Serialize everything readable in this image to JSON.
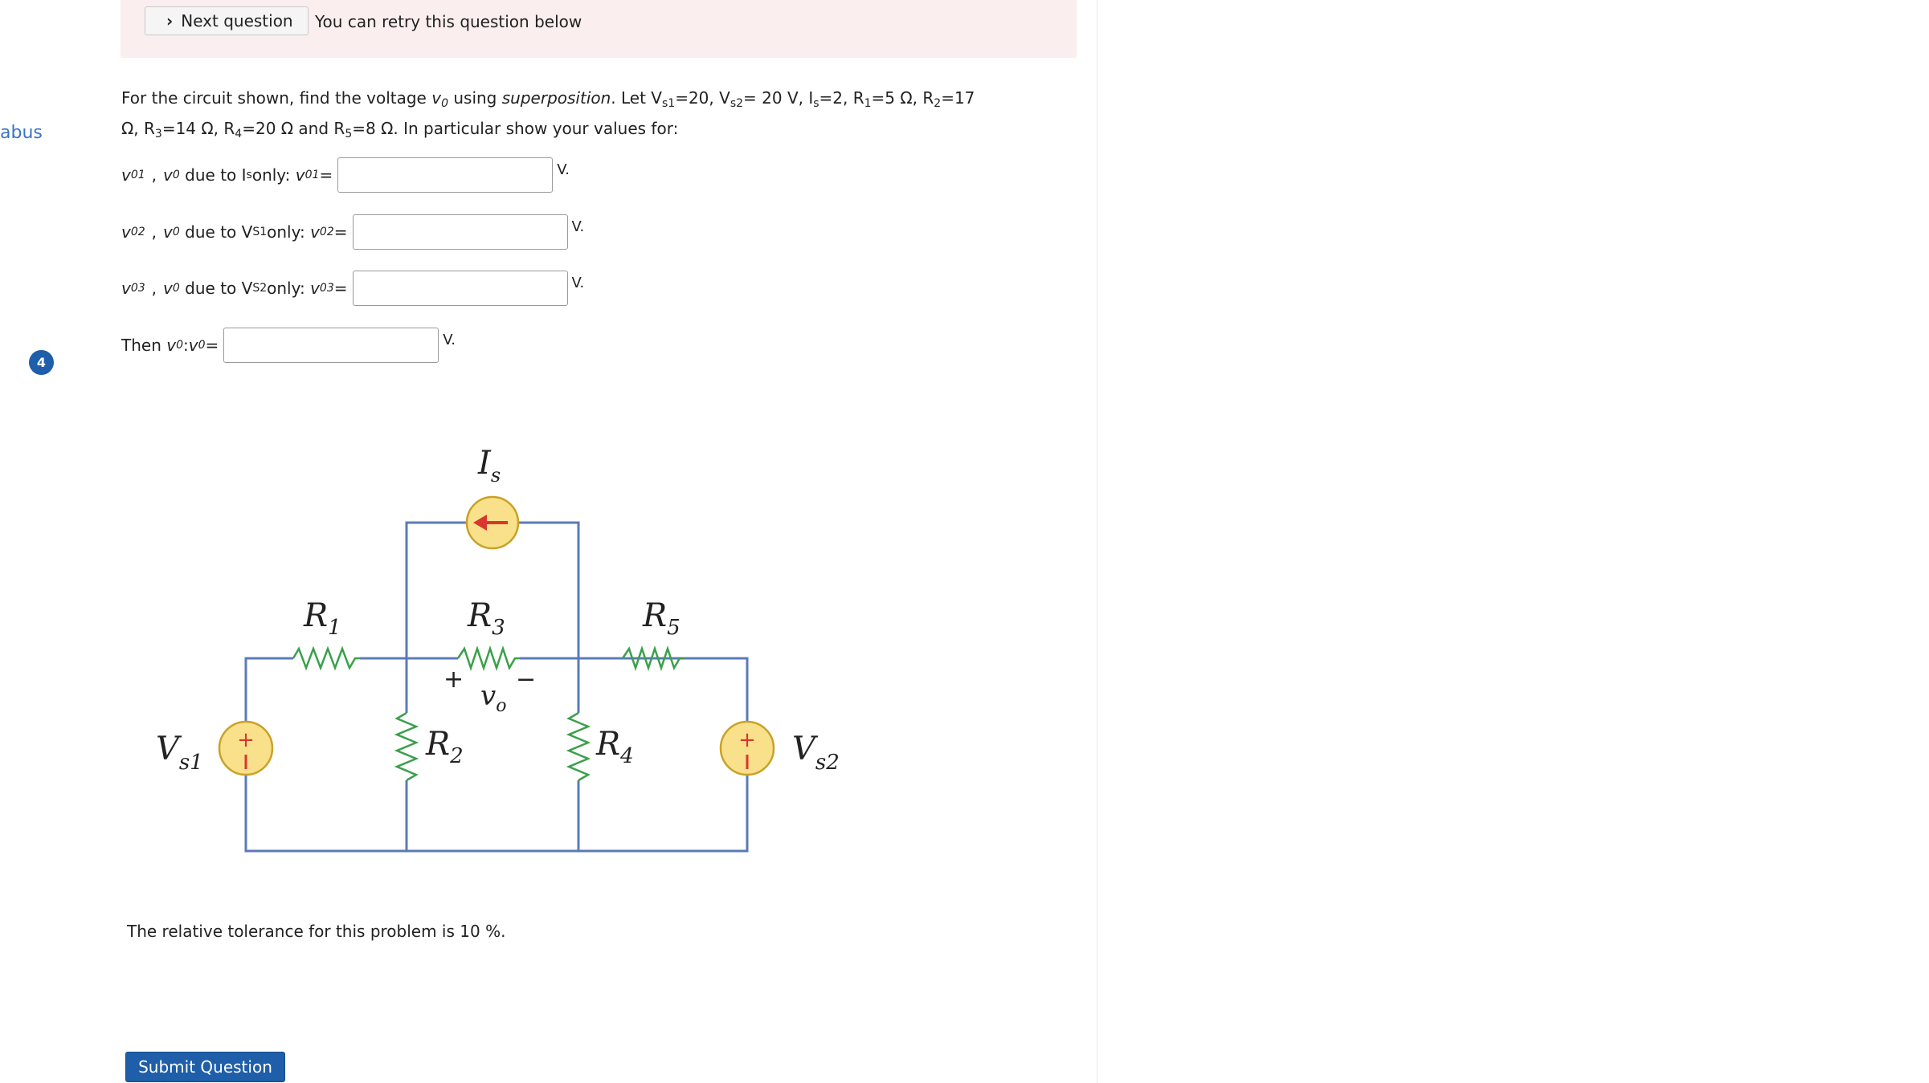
{
  "sidebar": {
    "link_fragment": "abus",
    "step_number": "4"
  },
  "banner": {
    "next_label": "Next question",
    "retry_text": "You can retry this question below"
  },
  "problem": {
    "p1": "For the circuit shown, find the  voltage ",
    "vo": "v",
    "vo_sub": "0",
    "p2": " using ",
    "method": "superposition",
    "p3": ". Let  V",
    "vs1_sub": "s1",
    "p4": "=20, V",
    "vs2_sub": "s2",
    "p5": "= 20 V,  I",
    "is_sub": "s",
    "p6": "=2,  R",
    "r1_sub": "1",
    "p7": "=5 Ω, R",
    "r2_sub": "2",
    "p8": "=17 Ω, R",
    "r3_sub": "3",
    "p9": "=14 Ω, R",
    "r4_sub": "4",
    "p10": "=20 Ω and  R",
    "r5_sub": "5",
    "p11": "=8 Ω. In particular show your values for:"
  },
  "answers": [
    {
      "var": "v",
      "var_sub": "01",
      "sep": ",",
      "v0": "v",
      "v0_sub": "0",
      "due": "due to I",
      "due_sub": "s",
      "only": " only:",
      "eq": "v",
      "eq_sub": "01",
      "eq_tail": "=",
      "value": "",
      "unit": "V."
    },
    {
      "var": "v",
      "var_sub": "02",
      "sep": ",",
      "v0": "v",
      "v0_sub": "0",
      "due": "due to V",
      "due_sub": "S1",
      "only": " only:",
      "eq": "v",
      "eq_sub": "02",
      "eq_tail": "=",
      "value": "",
      "unit": "V."
    },
    {
      "var": "v",
      "var_sub": "03",
      "sep": ",",
      "v0": "v",
      "v0_sub": "0",
      "due": "due to V",
      "due_sub": "S2",
      "only": " only:",
      "eq": "v",
      "eq_sub": "03",
      "eq_tail": "=",
      "value": "",
      "unit": "V."
    }
  ],
  "final": {
    "then": "Then ",
    "v0": "v",
    "v0_sub": "0",
    "colon": " : ",
    "eq": "v",
    "eq_sub": "0",
    "eq_tail": "=",
    "value": "",
    "unit": "V."
  },
  "circuit": {
    "is_label": "I",
    "is_sub": "s",
    "r1_label": "R",
    "r1_sub": "1",
    "r2_label": "R",
    "r2_sub": "2",
    "r3_label": "R",
    "r3_sub": "3",
    "r4_label": "R",
    "r4_sub": "4",
    "r5_label": "R",
    "r5_sub": "5",
    "vs1_label": "V",
    "vs1_sub": "s1",
    "vs2_label": "V",
    "vs2_sub": "s2",
    "vo_label": "v",
    "vo_sub": "o",
    "plus": "+",
    "minus": "−",
    "colors": {
      "wire": "#5b7bb8",
      "source_fill": "#f9e08a",
      "source_stroke": "#c9a227",
      "arrow": "#d9362f",
      "sign": "#d9362f"
    }
  },
  "tolerance_text": "The relative tolerance for this problem is 10 %.",
  "submit_label": "Submit Question"
}
